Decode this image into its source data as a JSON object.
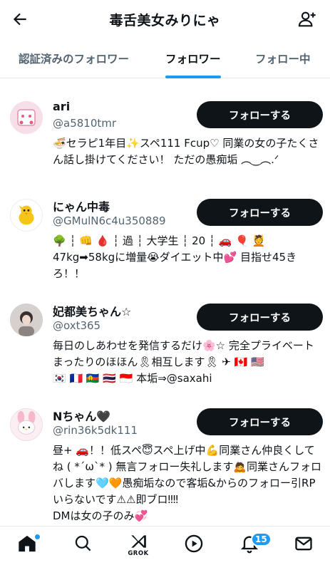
{
  "header": {
    "title": "毒舌美女みりにゃ"
  },
  "tabs": [
    {
      "label": "認証済みのフォロワー"
    },
    {
      "label": "フォロワー"
    },
    {
      "label": "フォロー中"
    }
  ],
  "users": [
    {
      "name": "ari",
      "handle": "@a5810tmr",
      "button": "フォローする",
      "bio": "🍜セラピ1年目✨スペ111 Fcup♡ 同業の女の子たくさん話し掛けてください！ ただの愚痴垢 ︵‿︵.ᐟ"
    },
    {
      "name": "にゃん中毒",
      "handle": "@GMulN6c4u350889",
      "button": "フォローする",
      "bio": "🌳 ┆ 👊 🩸 ┆ 過 ┆ 大学生 ┆ 20 ┆ 🚗 🎈 💆\n47kg➡58kgに増量😭ダイエット中💕 目指せ45きろ！！"
    },
    {
      "name": "妃都美ちゃん☆",
      "handle": "@oxt365",
      "button": "フォローする",
      "bio": "毎日のしあわせを発信するだけ🌸☆ 完全プライベートまったりのほほん🎗相互します🎗 ✈ 🇨🇦 🇺🇸\n🇰🇷 🇫🇷 🇳🇨 🇹🇭 🇮🇩 本垢⇒@saxahi"
    },
    {
      "name": "Nちゃん🖤",
      "handle": "@rin36k5dk111",
      "button": "フォローする",
      "bio": "昼+ 🚗！！低スペ😇スペ上げ中💪同業さん仲良くしてね ( *´ω`* ) 無言フォロー失礼します🙇同業さんフォロバします🩵🧡愚痴垢なので客垢&からのフォロー引RPいらないです⚠⚠即ブロ‼‼\nDMは女の子のみ💞"
    }
  ],
  "bottom_nav": {
    "grok_label": "GROK",
    "notifications_count": "15"
  },
  "colors": {
    "accent": "#1d9bf0",
    "button_bg": "#0f1419",
    "secondary_text": "#536471"
  }
}
